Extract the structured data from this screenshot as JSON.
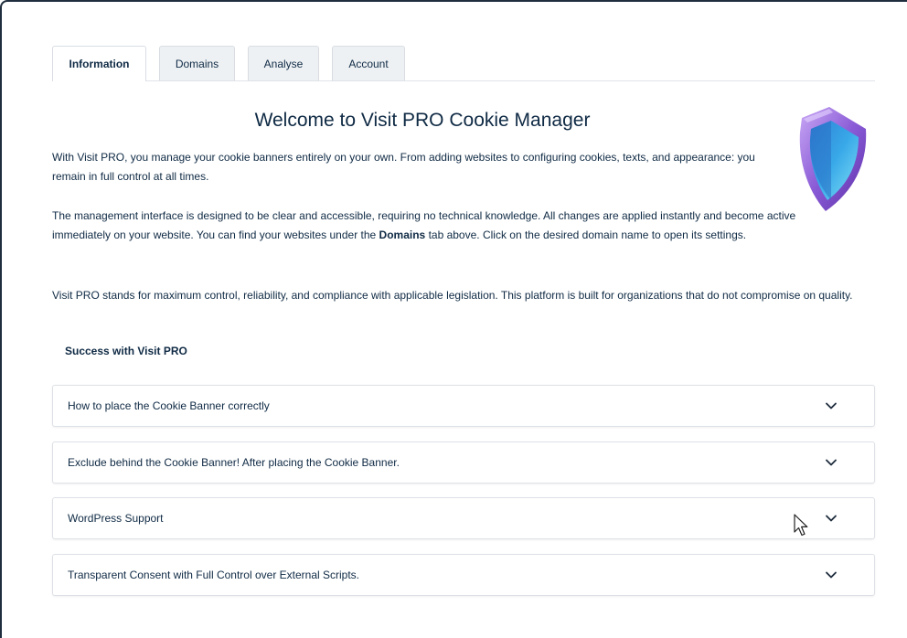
{
  "tabs": [
    {
      "label": "Information",
      "active": true
    },
    {
      "label": "Domains",
      "active": false
    },
    {
      "label": "Analyse",
      "active": false
    },
    {
      "label": "Account",
      "active": false
    }
  ],
  "main": {
    "title": "Welcome to Visit PRO Cookie Manager",
    "paragraph1": "With Visit PRO, you manage your cookie banners entirely on your own. From adding websites to configuring cookies, texts, and appearance: you remain in full control at all times.",
    "paragraph2_before": "The management interface is designed to be clear and accessible, requiring no technical knowledge. All changes are applied instantly and become active immediately on your website. You can find your websites under the ",
    "paragraph2_bold": "Domains",
    "paragraph2_after": " tab above. Click on the desired domain name to open its settings.",
    "paragraph3": "Visit PRO stands for maximum control, reliability, and compliance with applicable legislation. This platform is built for organizations that do not compromise on quality.",
    "success_heading": "Success with Visit PRO"
  },
  "accordion": [
    {
      "label": "How to place the Cookie Banner correctly",
      "icon": "chevron-down-icon"
    },
    {
      "label": "Exclude behind the Cookie Banner! After placing the Cookie Banner.",
      "icon": "chevron-down-icon"
    },
    {
      "label": "WordPress Support",
      "icon": "chevron-down-icon"
    },
    {
      "label": "Transparent Consent with Full Control over External Scripts.",
      "icon": "chevron-down-icon"
    }
  ],
  "icons": {
    "shield": "shield-icon",
    "cursor": "mouse-pointer-icon"
  },
  "colors": {
    "text": "#0f2a44",
    "shield_purple": "#8a5bd6",
    "shield_blue": "#38a8e8"
  }
}
